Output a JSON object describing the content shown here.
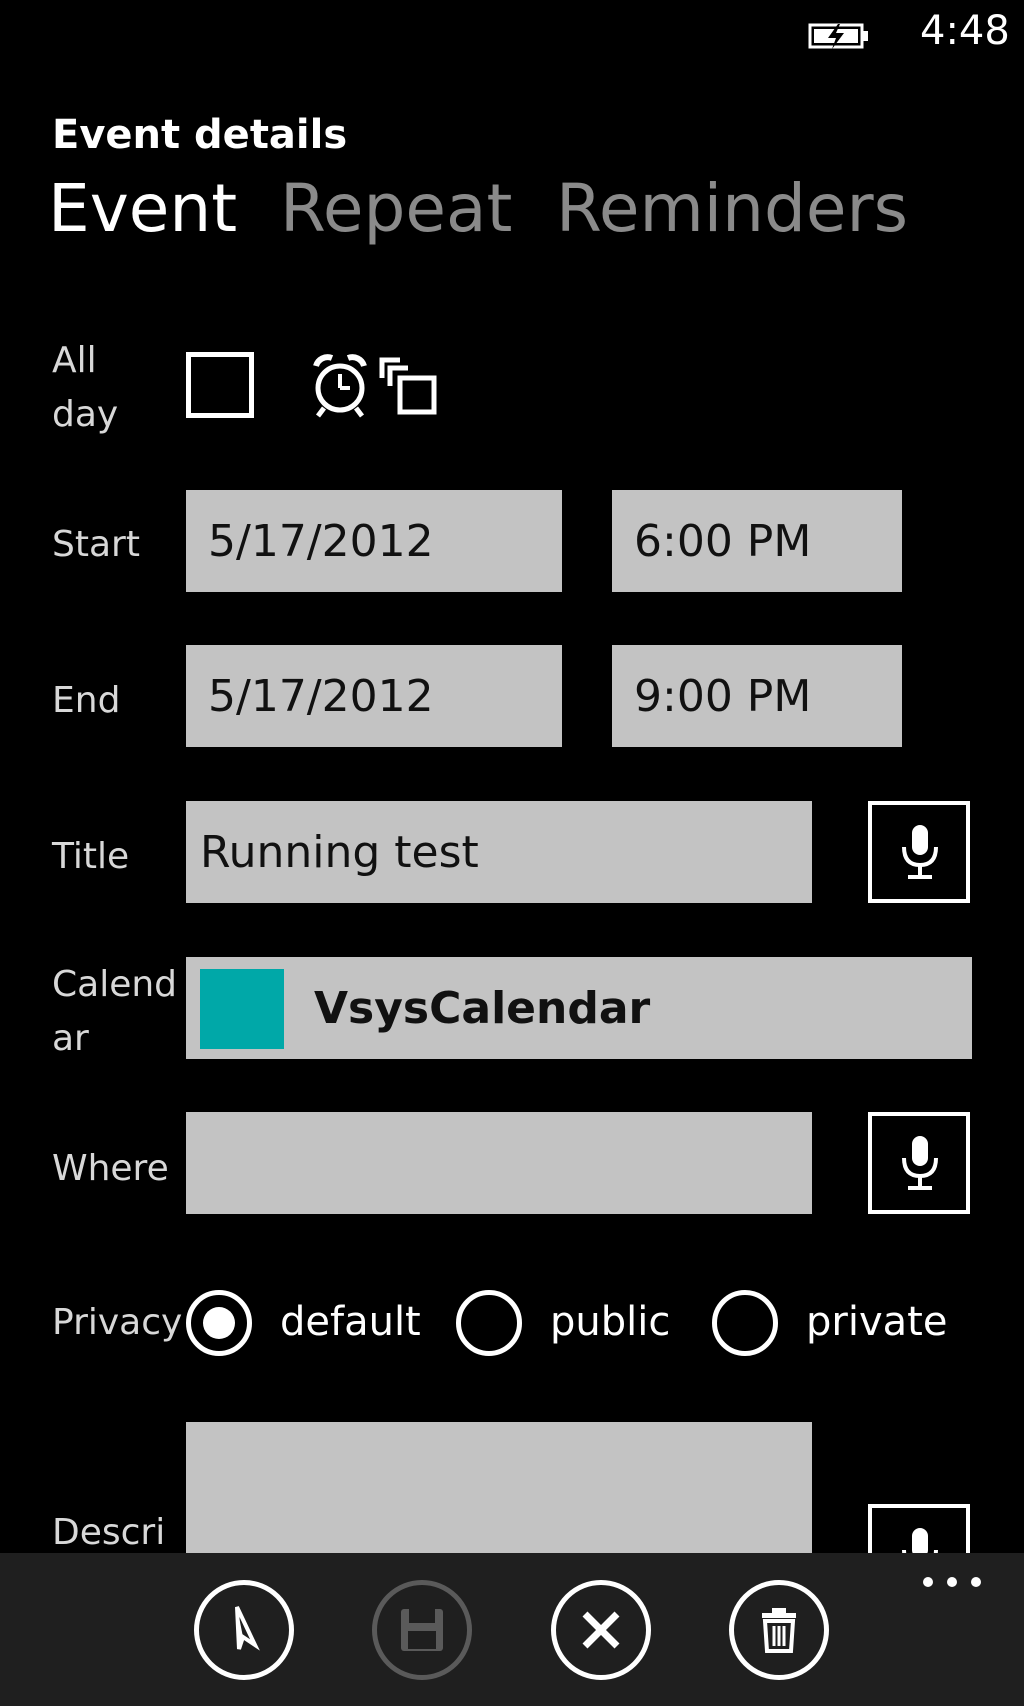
{
  "status_bar": {
    "time": "4:48"
  },
  "header": {
    "app_title": "Event details",
    "tabs": [
      {
        "label": "Event",
        "active": true
      },
      {
        "label": "Repeat",
        "active": false
      },
      {
        "label": "Reminders",
        "active": false
      }
    ]
  },
  "form": {
    "all_day": {
      "label_line1": "All",
      "label_line2": "day",
      "checked": false
    },
    "start": {
      "label": "Start",
      "date": "5/17/2012",
      "time": "6:00 PM"
    },
    "end": {
      "label": "End",
      "date": "5/17/2012",
      "time": "9:00 PM"
    },
    "title": {
      "label": "Title",
      "value": "Running test"
    },
    "calendar": {
      "label_line1": "Calend",
      "label_line2": "ar",
      "value": "VsysCalendar",
      "color": "#00a8a8"
    },
    "where": {
      "label": "Where",
      "value": ""
    },
    "privacy": {
      "label": "Privacy",
      "options": [
        {
          "label": "default",
          "selected": true
        },
        {
          "label": "public",
          "selected": false
        },
        {
          "label": "private",
          "selected": false
        }
      ]
    },
    "description": {
      "label": "Descri",
      "value": ""
    }
  },
  "app_bar": {
    "buttons": [
      {
        "icon": "compass-icon",
        "enabled": true
      },
      {
        "icon": "save-icon",
        "enabled": false
      },
      {
        "icon": "close-icon",
        "enabled": true
      },
      {
        "icon": "delete-icon",
        "enabled": true
      }
    ],
    "more_icon": "more-icon"
  },
  "colors": {
    "background": "#000000",
    "field": "#c3c3c3",
    "accent_teal": "#00a8a8",
    "inactive_text": "#8a8a8a",
    "app_bar": "#1f1f1f"
  }
}
